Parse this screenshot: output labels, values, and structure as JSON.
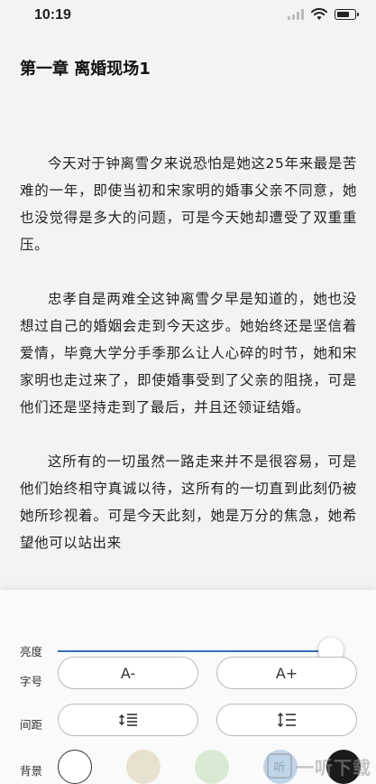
{
  "status_bar": {
    "time": "10:19"
  },
  "reader": {
    "chapter_title": "第一章 离婚现场1",
    "paragraphs": [
      "今天对于钟离雪夕来说恐怕是她这25年来最是苦难的一年，即使当初和宋家明的婚事父亲不同意，她也没觉得是多大的问题，可是今天她却遭受了双重重压。",
      "忠孝自是两难全这钟离雪夕早是知道的，她也没想过自己的婚姻会走到今天这步。她始终还是坚信着爱情，毕竟大学分手季那么让人心碎的时节，她和宋家明也走过来了，即使婚事受到了父亲的阻挠，可是他们还是坚持走到了最后，并且还领证结婚。",
      "这所有的一切虽然一路走来并不是很容易，可是他们始终相守真诚以待，这所有的一切直到此刻仍被她所珍视着。可是今天此刻，她是万分的焦急，她希望他可以站出来"
    ]
  },
  "settings": {
    "brightness_label": "亮度",
    "brightness_value": 0.96,
    "font_size_label": "字号",
    "font_decrease": "A-",
    "font_increase": "A+",
    "spacing_label": "间距",
    "background_label": "背景",
    "background_colors": [
      "#ffffff",
      "#e9e1cf",
      "#d9ead3",
      "#bfd6ea",
      "#1a1a1a"
    ]
  },
  "watermark": {
    "icon_text": "听",
    "text": "一听下载"
  }
}
